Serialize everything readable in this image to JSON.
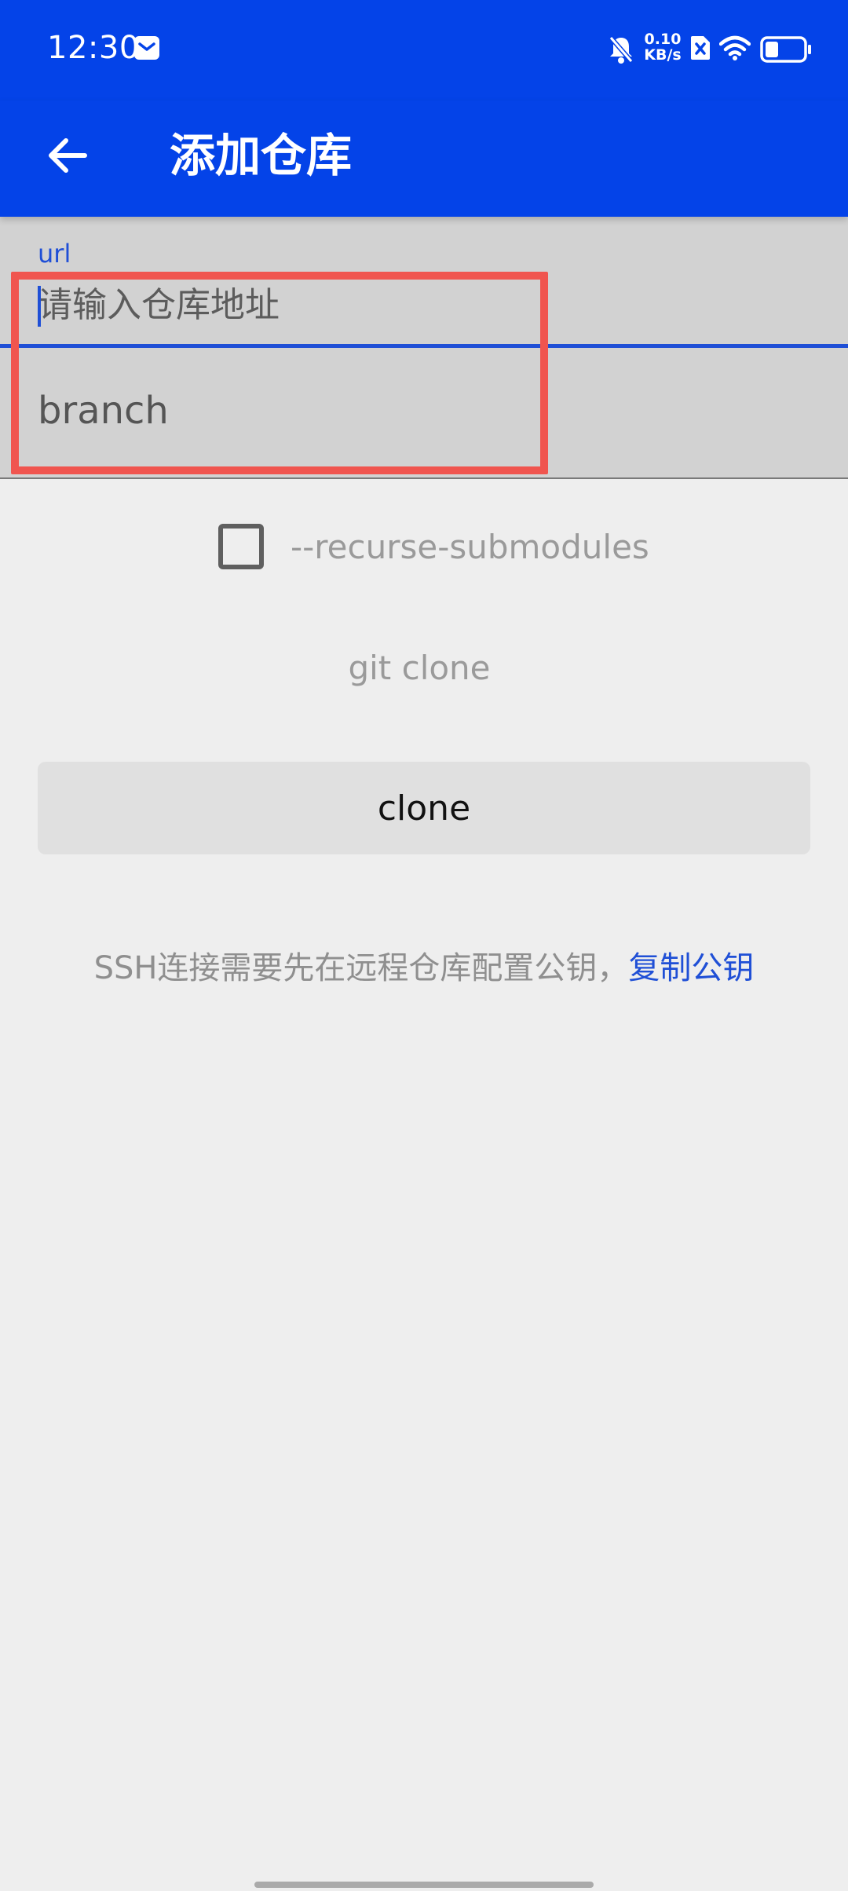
{
  "status_bar": {
    "time": "12:30",
    "net_speed_value": "0.10",
    "net_speed_unit": "KB/s",
    "icons": [
      "mail-icon",
      "mute-bell-icon",
      "sim-off-icon",
      "wifi-icon",
      "battery-icon"
    ],
    "battery_level": 0.35
  },
  "app_bar": {
    "title": "添加仓库",
    "back_icon": "arrow-left-icon"
  },
  "form": {
    "url_label": "url",
    "url_placeholder": "请输入仓库地址",
    "branch_placeholder": "branch"
  },
  "options": {
    "recurse_submodules_label": "--recurse-submodules",
    "recurse_submodules_checked": false
  },
  "command_preview": "git clone",
  "clone_button_label": "clone",
  "ssh_note": {
    "text": "SSH连接需要先在远程仓库配置公钥，",
    "link": "复制公钥"
  },
  "colors": {
    "primary": "#0443e8",
    "accent": "#1f4fd6",
    "highlight": "#f0554f"
  }
}
